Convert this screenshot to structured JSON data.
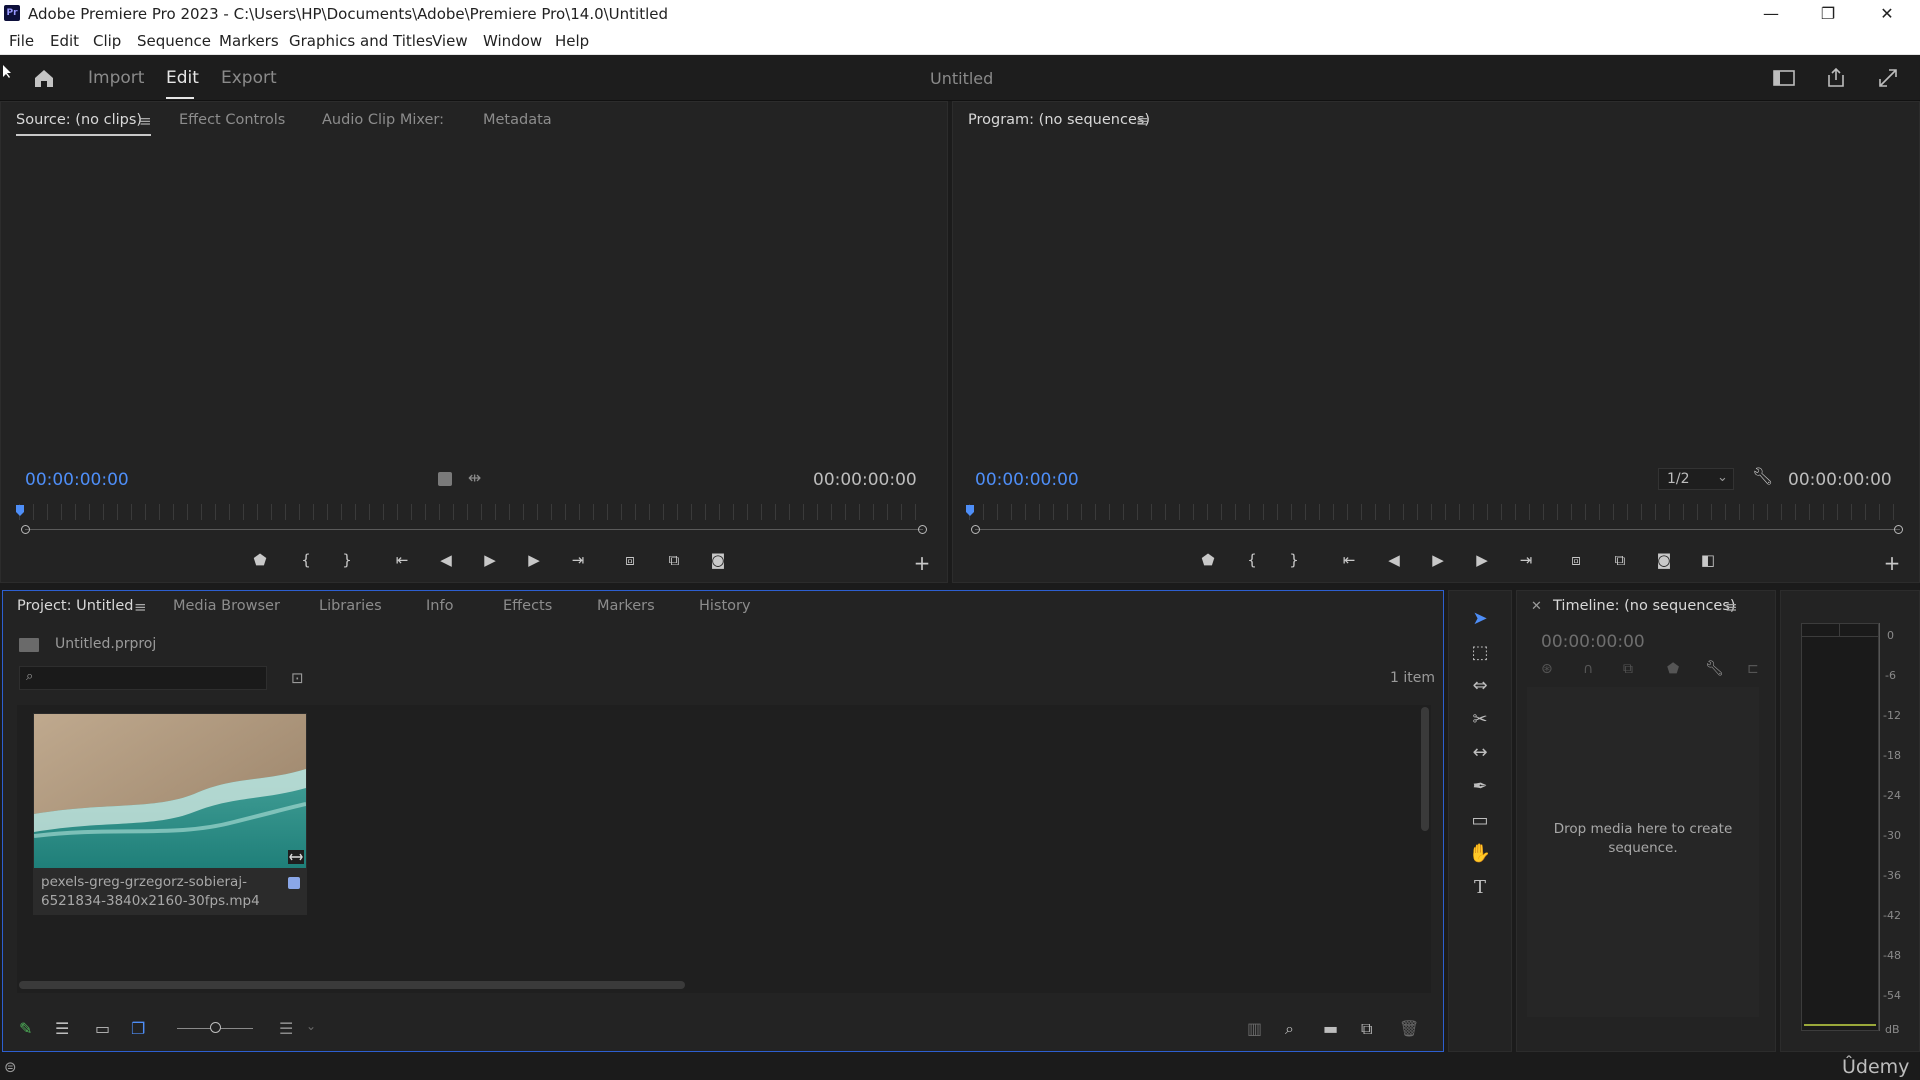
{
  "window": {
    "title": "Adobe Premiere Pro 2023 - C:\\Users\\HP\\Documents\\Adobe\\Premiere Pro\\14.0\\Untitled",
    "app_icon": "Pr",
    "minimize": "—",
    "restore": "❐",
    "close": "✕"
  },
  "menu": [
    "File",
    "Edit",
    "Clip",
    "Sequence",
    "Markers",
    "Graphics and Titles",
    "View",
    "Window",
    "Help"
  ],
  "workspace": {
    "tabs": [
      "Import",
      "Edit",
      "Export"
    ],
    "active": "Edit",
    "doc_title": "Untitled"
  },
  "source_panel": {
    "tabs": [
      "Source: (no clips)",
      "Effect Controls",
      "Audio Clip Mixer:",
      "Metadata"
    ],
    "timecode_in": "00:00:00:00",
    "timecode_out": "00:00:00:00"
  },
  "program_panel": {
    "tab": "Program: (no sequences)",
    "timecode_in": "00:00:00:00",
    "timecode_out": "00:00:00:00",
    "zoom": "1/2"
  },
  "project_panel": {
    "tabs": [
      "Project: Untitled",
      "Media Browser",
      "Libraries",
      "Info",
      "Effects",
      "Markers",
      "History"
    ],
    "project_file": "Untitled.prproj",
    "search_placeholder": "",
    "item_count": "1 item",
    "clip_name_line1": "pexels-greg-grzegorz-sobieraj-",
    "clip_name_line2": "6521834-3840x2160-30fps.mp4"
  },
  "timeline_panel": {
    "tab": "Timeline: (no sequences)",
    "timecode": "00:00:00:00",
    "drop_hint_line1": "Drop media here to create",
    "drop_hint_line2": "sequence."
  },
  "audio_meter": {
    "ticks": [
      "0",
      "-6",
      "-12",
      "-18",
      "-24",
      "-30",
      "-36",
      "-42",
      "-48",
      "-54",
      "dB"
    ]
  },
  "watermark": "Ûdemy",
  "colors": {
    "accent_blue": "#4e8ef7",
    "panel_bg": "#232323",
    "active_panel_border": "#2d5fd0"
  }
}
